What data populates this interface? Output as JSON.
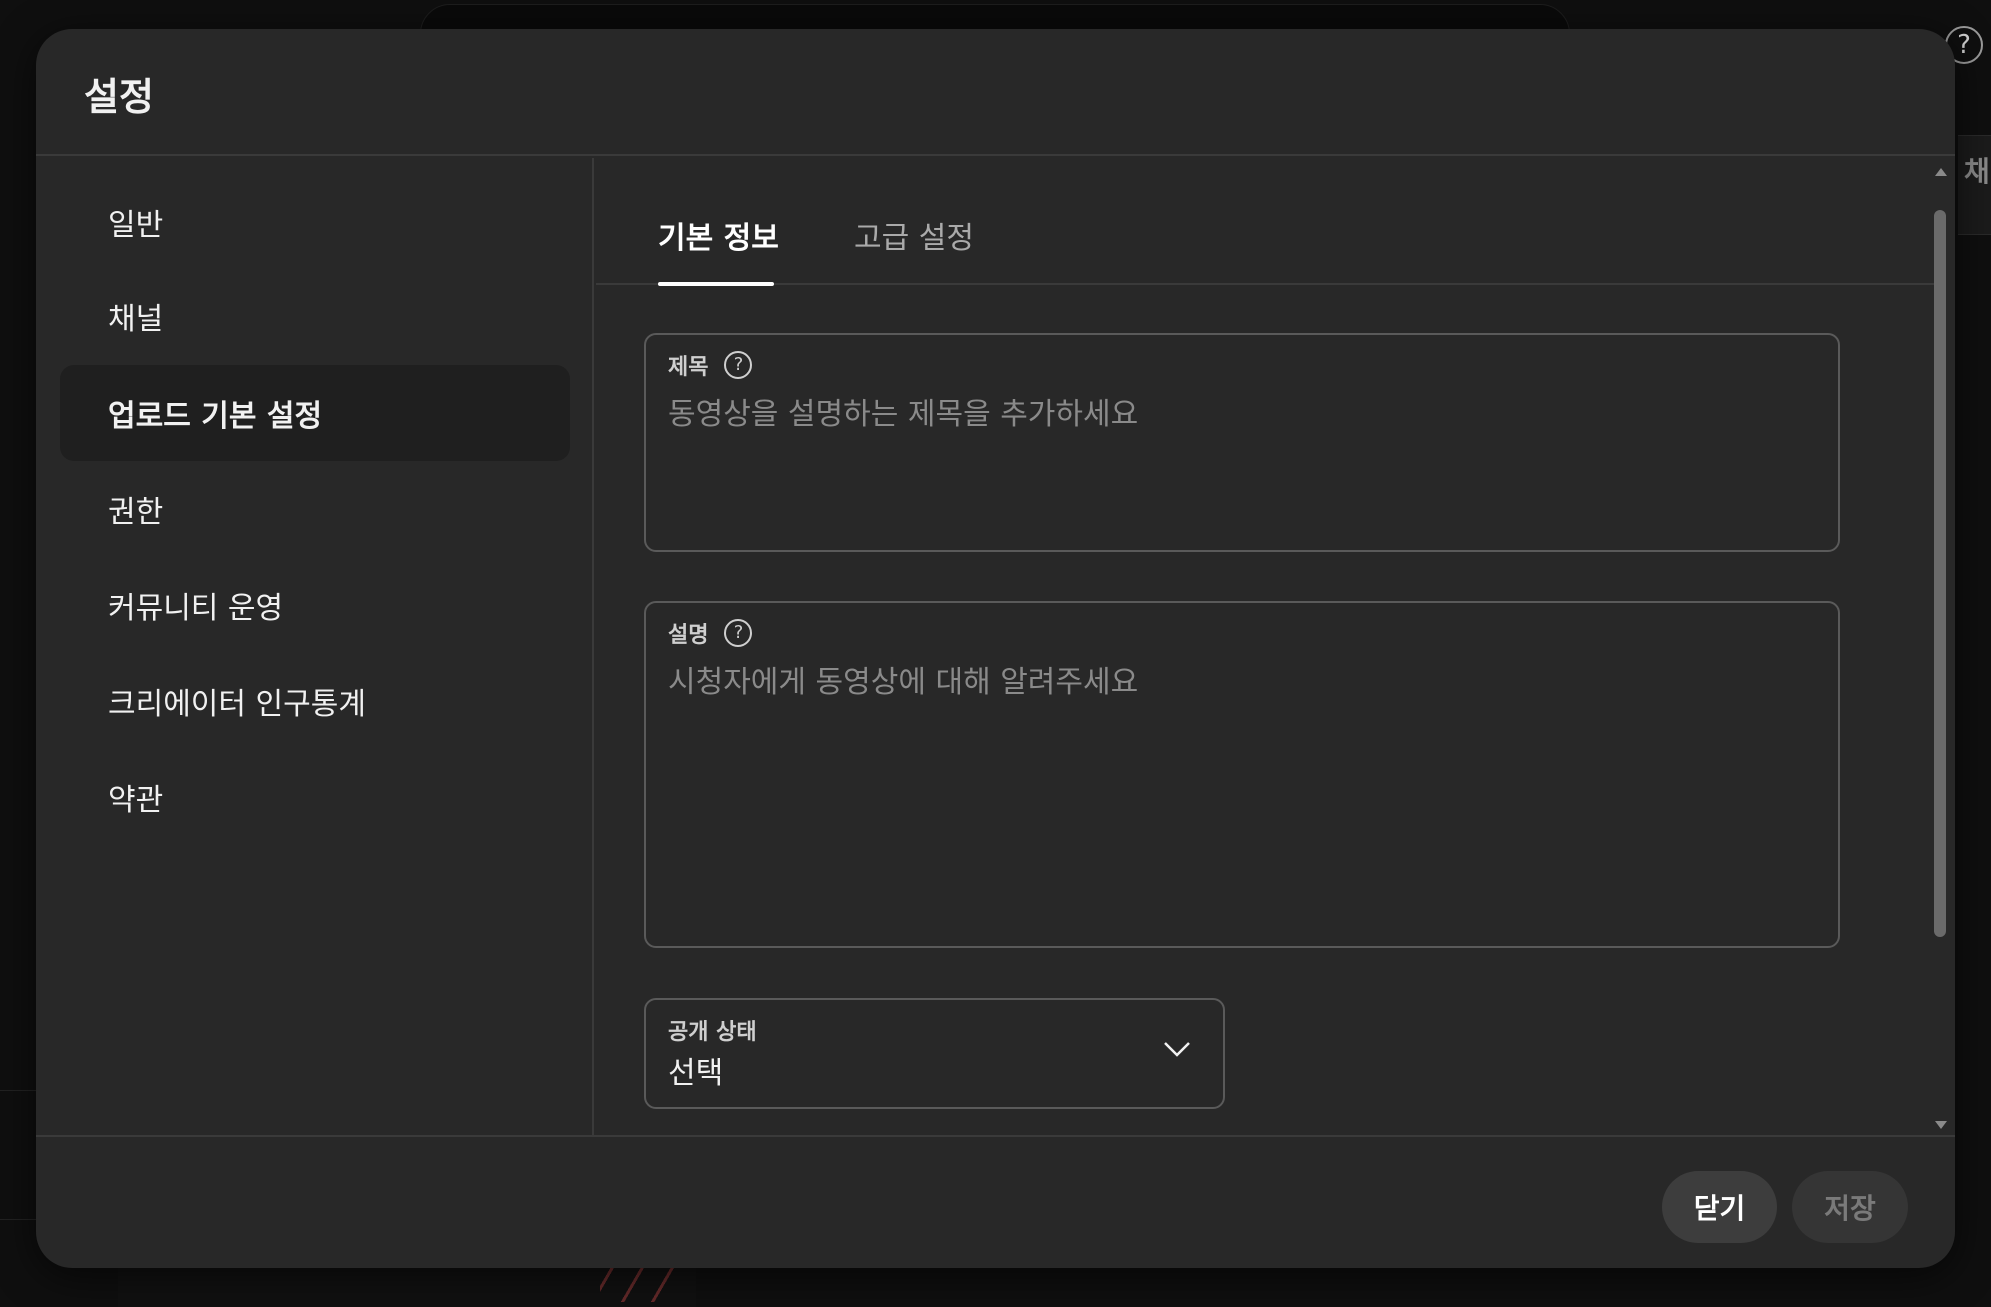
{
  "background": {
    "help_icon": "?",
    "right_panel_text": "채"
  },
  "modal": {
    "title": "설정",
    "nav": {
      "items": [
        {
          "label": "일반",
          "active": false
        },
        {
          "label": "채널",
          "active": false
        },
        {
          "label": "업로드 기본 설정",
          "active": true
        },
        {
          "label": "권한",
          "active": false
        },
        {
          "label": "커뮤니티 운영",
          "active": false
        },
        {
          "label": "크리에이터 인구통계",
          "active": false
        },
        {
          "label": "약관",
          "active": false
        }
      ]
    },
    "tabs": [
      {
        "label": "기본 정보",
        "active": true
      },
      {
        "label": "고급 설정",
        "active": false
      }
    ],
    "fields": {
      "title": {
        "label": "제목",
        "help_icon": "question-circle-icon",
        "placeholder": "동영상을 설명하는 제목을 추가하세요"
      },
      "description": {
        "label": "설명",
        "help_icon": "question-circle-icon",
        "placeholder": "시청자에게 동영상에 대해 알려주세요"
      },
      "visibility": {
        "label": "공개 상태",
        "value": "선택",
        "icon": "chevron-down-icon"
      }
    },
    "footer": {
      "close_label": "닫기",
      "save_label": "저장",
      "save_enabled": false
    }
  }
}
